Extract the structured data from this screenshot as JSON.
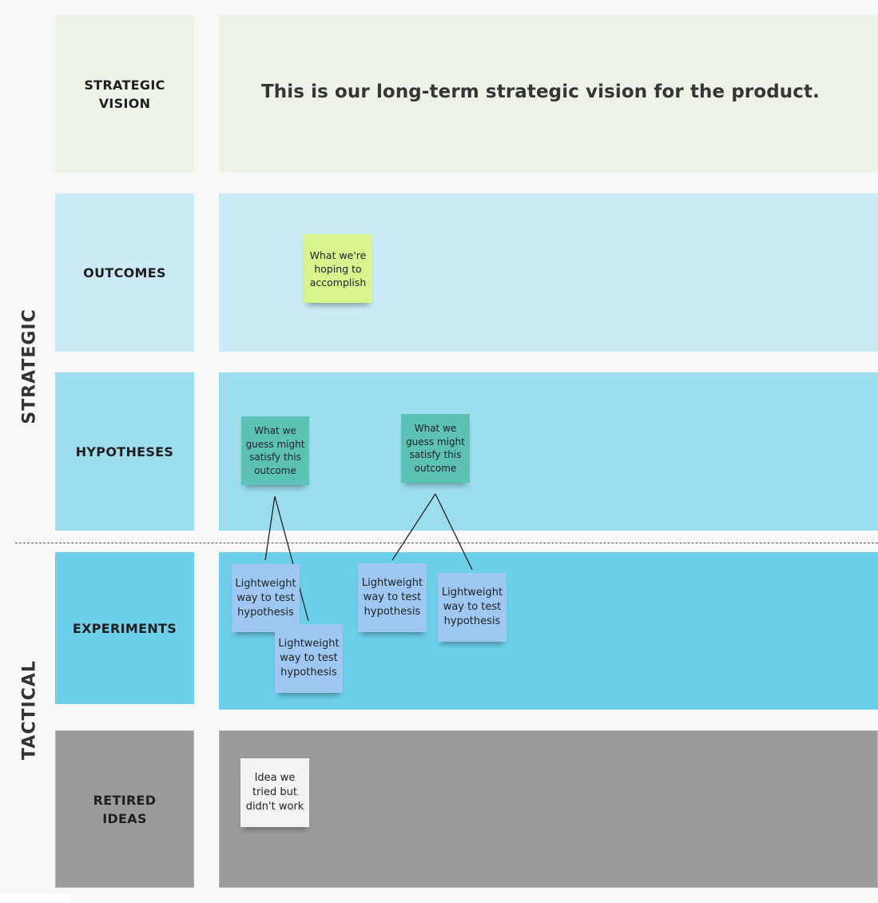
{
  "side_labels": {
    "strategic": "STRATEGIC",
    "tactical": "TACTICAL"
  },
  "rows": {
    "vision": {
      "label": "STRATEGIC\nVISION",
      "statement": "This is our long-term strategic vision for the product."
    },
    "outcomes": {
      "label": "OUTCOMES"
    },
    "hypotheses": {
      "label": "HYPOTHESES"
    },
    "experiments": {
      "label": "EXPERIMENTS"
    },
    "retired": {
      "label": "RETIRED\nIDEAS"
    }
  },
  "stickies": {
    "outcome_1": "What we're\nhoping to\naccomplish",
    "hypothesis_1": "What we\nguess might\nsatisfy this\noutcome",
    "hypothesis_2": "What we\nguess might\nsatisfy this\noutcome",
    "experiment_1": "Lightweight\nway to test\nhypothesis",
    "experiment_2": "Lightweight\nway to test\nhypothesis",
    "experiment_3": "Lightweight\nway to test\nhypothesis",
    "experiment_4": "Lightweight\nway to test\nhypothesis",
    "retired_1": "Idea we\ntried but\ndidn't work"
  },
  "colors": {
    "vision_bg": "#edf3e6",
    "outcomes_bg": "#caebf5",
    "hypotheses_bg": "#9cdeee",
    "experiments_bg": "#6cd0eb",
    "retired_bg": "#9b9b9b",
    "sticky_lime": "#d7f58c",
    "sticky_teal": "#5cc2b6",
    "sticky_blue": "#9ec8f2",
    "sticky_white": "#f2f3f5"
  }
}
